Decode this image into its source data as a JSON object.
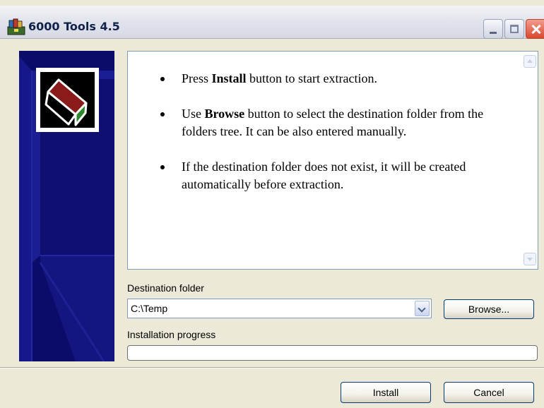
{
  "window": {
    "title": "6000 Tools 4.5"
  },
  "info": {
    "items": [
      {
        "pre": "Press ",
        "bold": "Install",
        "post": " button to start extraction."
      },
      {
        "pre": "Use ",
        "bold": "Browse",
        "post": " button to select the destination folder from the folders tree. It can be also entered manually."
      },
      {
        "pre": "If the destination folder does not exist, it will be created automatically before extraction.",
        "bold": "",
        "post": ""
      }
    ]
  },
  "destination": {
    "label": "Destination folder",
    "value": "C:\\Temp",
    "browse_label": "Browse..."
  },
  "progress": {
    "label": "Installation progress",
    "value": 0
  },
  "footer": {
    "install_label": "Install",
    "cancel_label": "Cancel"
  },
  "colors": {
    "banner": "#0b0c6a",
    "panel_border": "#7f9db9",
    "button_border": "#003c74"
  },
  "icons": {
    "app": "archive-books-icon",
    "logo": "box-icon"
  }
}
